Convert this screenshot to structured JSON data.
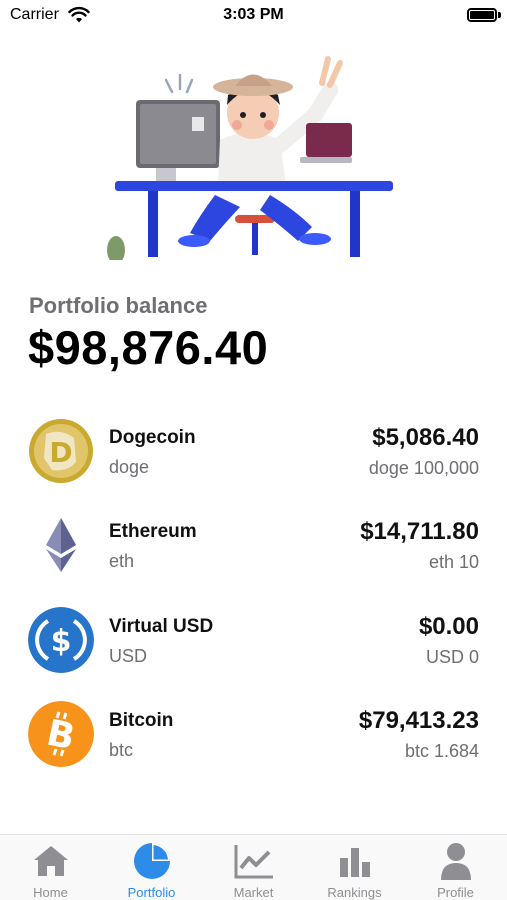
{
  "status_bar": {
    "carrier": "Carrier",
    "time": "3:03 PM"
  },
  "portfolio": {
    "balance_label": "Portfolio balance",
    "balance_value": "$98,876.40"
  },
  "assets": [
    {
      "name": "Dogecoin",
      "ticker": "doge",
      "value": "$5,086.40",
      "holding": "doge 100,000",
      "icon": "dogecoin-icon",
      "color": "#c9a92e"
    },
    {
      "name": "Ethereum",
      "ticker": "eth",
      "value": "$14,711.80",
      "holding": "eth 10",
      "icon": "ethereum-icon",
      "color": "#6c6f9a"
    },
    {
      "name": "Virtual USD",
      "ticker": "USD",
      "value": "$0.00",
      "holding": "USD 0",
      "icon": "usd-coin-icon",
      "color": "#2775ca"
    },
    {
      "name": "Bitcoin",
      "ticker": "btc",
      "value": "$79,413.23",
      "holding": "btc 1.684",
      "icon": "bitcoin-icon",
      "color": "#f7931a"
    }
  ],
  "tabs": [
    {
      "label": "Home",
      "icon": "home-icon",
      "active": false
    },
    {
      "label": "Portfolio",
      "icon": "pie-chart-icon",
      "active": true
    },
    {
      "label": "Market",
      "icon": "line-chart-icon",
      "active": false
    },
    {
      "label": "Rankings",
      "icon": "bar-chart-icon",
      "active": false
    },
    {
      "label": "Profile",
      "icon": "person-icon",
      "active": false
    }
  ],
  "colors": {
    "accent": "#2d8ce8",
    "inactive": "#8e8e93"
  }
}
